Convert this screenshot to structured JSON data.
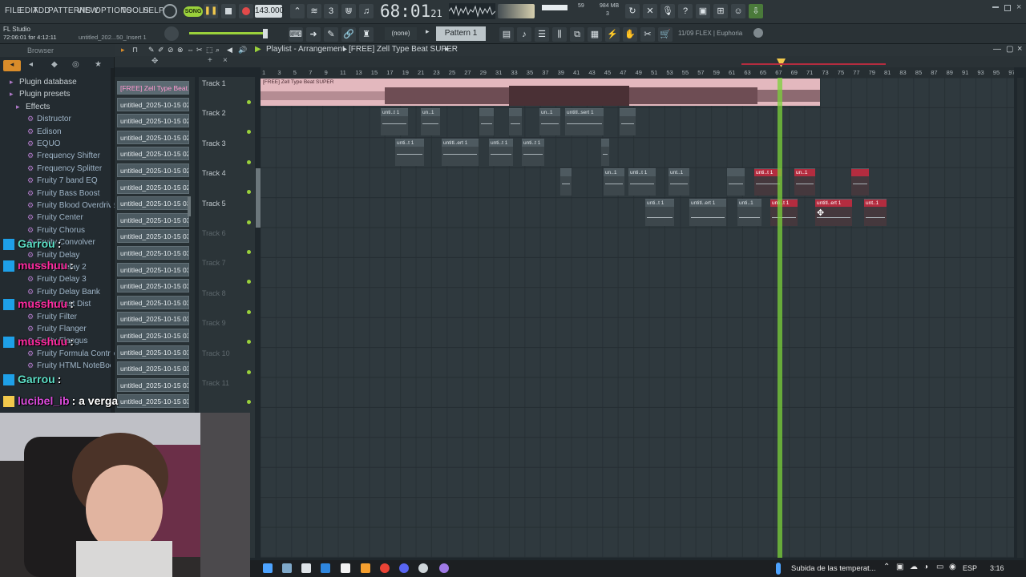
{
  "topbar": {
    "menus": [
      "FILE",
      "EDIT",
      "ADD",
      "PATTERNS",
      "VIEW",
      "OPTIONS",
      "TOOLS",
      "HELP"
    ],
    "song_btn": "SONG",
    "tempo": "143.000",
    "time_main": "68:01",
    "time_sub": "21",
    "cpu_value": "59",
    "mem_value": "984 MB",
    "poly_value": "3",
    "app_name": "FL Studio",
    "project_time": "72:06:01 for 4:12:11",
    "project_name": "untitled_202...50_Insert 1"
  },
  "toolbar2": {
    "snap_value": "(none)",
    "pattern_name": "Pattern 1",
    "news_text": "11/09  FLEX | Euphoria"
  },
  "browser": {
    "title": "Browser",
    "items": [
      "Plugin database",
      "Plugin presets",
      "Effects",
      "Distructor",
      "Edison",
      "EQUO",
      "Frequency Shifter",
      "Frequency Splitter",
      "Fruity 7 band EQ",
      "Fruity Bass Boost",
      "Fruity Blood Overdrive",
      "Fruity Center",
      "Fruity Chorus",
      "Fruity Convolver",
      "Fruity Delay",
      "Fruity Delay 2",
      "Fruity Delay 3",
      "Fruity Delay Bank",
      "Fruity Fast Dist",
      "Fruity Filter",
      "Fruity Flanger",
      "Fruity Flangus",
      "Fruity Formula Controller",
      "Fruity HTML NoteBook"
    ]
  },
  "channels": [
    "[FREE] Zell Type Beat...",
    "untitled_2025-10-15 02-...",
    "untitled_2025-10-15 02-...",
    "untitled_2025-10-15 02-...",
    "untitled_2025-10-15 02-...",
    "untitled_2025-10-15 02-...",
    "untitled_2025-10-15 02-...",
    "untitled_2025-10-15 03-...",
    "untitled_2025-10-15 03-...",
    "untitled_2025-10-15 03-...",
    "untitled_2025-10-15 03-...",
    "untitled_2025-10-15 03-...",
    "untitled_2025-10-15 03-...",
    "untitled_2025-10-15 03-...",
    "untitled_2025-10-15 03-...",
    "untitled_2025-10-15 03-...",
    "untitled_2025-10-15 03-...",
    "untitled_2025-10-15 03-...",
    "untitled_2025-10-15 03-...",
    "untitled_2025-10-15 03-..."
  ],
  "playlist": {
    "title": "Playlist - Arrangement",
    "song": "[FREE] Zell Type Beat  SUPER",
    "ruler": [
      "1",
      "3",
      "5",
      "7",
      "9",
      "11",
      "13",
      "15",
      "17",
      "19",
      "21",
      "23",
      "25",
      "27",
      "29",
      "31",
      "33",
      "35",
      "37",
      "39",
      "41",
      "43",
      "45",
      "47",
      "49",
      "51",
      "53",
      "55",
      "57",
      "59",
      "61",
      "63",
      "65",
      "67",
      "69",
      "71",
      "73",
      "75",
      "77",
      "79",
      "81",
      "83",
      "85",
      "87",
      "89",
      "91",
      "93",
      "95",
      "97"
    ],
    "tracks": [
      "Track 1",
      "Track 2",
      "Track 3",
      "Track 4",
      "Track 5",
      "Track 6",
      "Track 7",
      "Track 8",
      "Track 9",
      "Track 10",
      "Track 11"
    ],
    "audio_clip_label": "[FREE] Zell Type Beat  SUPER",
    "clip_labels": {
      "t2": [
        "unti..t 1",
        "un..1",
        "",
        "",
        "un..1",
        "untitl..sert 1",
        ""
      ],
      "t3": [
        "unti..t 1",
        "untitl..ert 1",
        "unti..t 1",
        "unti..t 1",
        ""
      ],
      "t4": [
        "",
        "un..1",
        "unti..t 1",
        "unt..1",
        "",
        "unti..t 1",
        "un..1",
        ""
      ],
      "t5": [
        "unti..t 1",
        "untitl..ert 1",
        "unti..1",
        "unti..t 1",
        "untitl..ert 1",
        "unt..1"
      ]
    }
  },
  "chat": [
    {
      "user": "Garrou",
      "text": ":"
    },
    {
      "user": "musshuu",
      "text": ":"
    },
    {
      "user": "musshuu",
      "text": ":"
    },
    {
      "user": "musshuu",
      "text": ":"
    },
    {
      "user": "Garrou",
      "text": ":"
    },
    {
      "user": "lucibel_ib",
      "text": ": a verga"
    }
  ],
  "taskbar": {
    "weather": "Subida de las temperat...",
    "lang": "ESP",
    "clock": "3:16"
  },
  "colors": {
    "accent_green": "#9ad13b",
    "clip_red": "#b42c3f",
    "audio_clip": "#e3b8be",
    "playhead": "#7bd13a",
    "chat_pink": "#ff2aa0",
    "chat_teal": "#5de0c8"
  }
}
